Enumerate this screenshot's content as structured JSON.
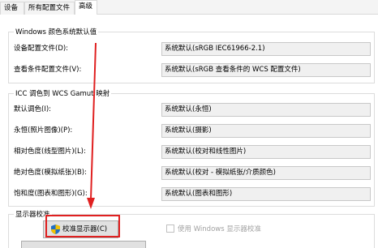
{
  "tabs": [
    "设备",
    "所有配置文件",
    "高级"
  ],
  "windows_defaults": {
    "title": "Windows 颜色系统默认值",
    "rows": [
      {
        "label": "设备配置文件(D):",
        "value": "系统默认(sRGB IEC61966-2.1)"
      },
      {
        "label": "查看条件配置文件(V):",
        "value": "系统默认(sRGB 查看条件的 WCS 配置文件)"
      }
    ]
  },
  "gamut": {
    "title": "ICC 调色到 WCS Gamut 映射",
    "rows": [
      {
        "label": "默认调色(I):",
        "value": "系统默认(永恒)"
      },
      {
        "label": "永恒(照片图像)(P):",
        "value": "系统默认(摄影)"
      },
      {
        "label": "相对色度(线型图片)(L):",
        "value": "系统默认(校对和线性图片)"
      },
      {
        "label": "绝对色度(模拟纸张)(B):",
        "value": "系统默认(校对 - 模拟纸张/介质颜色)"
      },
      {
        "label": "饱和度(图表和图形)(G):",
        "value": "系统默认(图表和图形)"
      }
    ]
  },
  "calibration": {
    "title": "显示器校准",
    "button_label": "校准显示器(C)",
    "checkbox_label": "使用 Windows 显示器校准"
  },
  "colors": {
    "highlight": "#e02020",
    "arrow": "#e02020"
  }
}
